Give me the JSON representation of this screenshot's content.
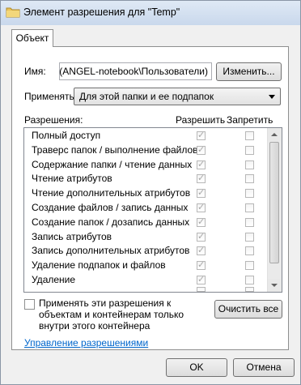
{
  "window": {
    "title": "Элемент разрешения для \"Temp\""
  },
  "tab": {
    "label": "Объект"
  },
  "name_field": {
    "label": "Имя:",
    "value": "и (ANGEL-notebook\\Пользователи)"
  },
  "change_button": {
    "label": "Изменить..."
  },
  "apply_to": {
    "label": "Применять:",
    "selected": "Для этой папки и ее подпапок"
  },
  "permissions": {
    "header": "Разрешения:",
    "allow_header": "Разрешить",
    "deny_header": "Запретить",
    "rows": [
      {
        "name": "Полный доступ",
        "allow": true,
        "deny": false
      },
      {
        "name": "Траверс папок / выполнение файлов",
        "allow": true,
        "deny": false
      },
      {
        "name": "Содержание папки / чтение данных",
        "allow": true,
        "deny": false
      },
      {
        "name": "Чтение атрибутов",
        "allow": true,
        "deny": false
      },
      {
        "name": "Чтение дополнительных атрибутов",
        "allow": true,
        "deny": false
      },
      {
        "name": "Создание файлов / запись данных",
        "allow": true,
        "deny": false
      },
      {
        "name": "Создание папок / дозапись данных",
        "allow": true,
        "deny": false
      },
      {
        "name": "Запись атрибутов",
        "allow": true,
        "deny": false
      },
      {
        "name": "Запись дополнительных атрибутов",
        "allow": true,
        "deny": false
      },
      {
        "name": "Удаление подпапок и файлов",
        "allow": true,
        "deny": false
      },
      {
        "name": "Удаление",
        "allow": true,
        "deny": false
      }
    ]
  },
  "apply_inherit": {
    "text": "Применять эти разрешения к объектам и контейнерам только внутри этого контейнера",
    "checked": false
  },
  "clear_all_button": {
    "label": "Очистить все"
  },
  "manage_link": {
    "label": "Управление разрешениями"
  },
  "ok_button": {
    "label": "OK"
  },
  "cancel_button": {
    "label": "Отмена"
  }
}
